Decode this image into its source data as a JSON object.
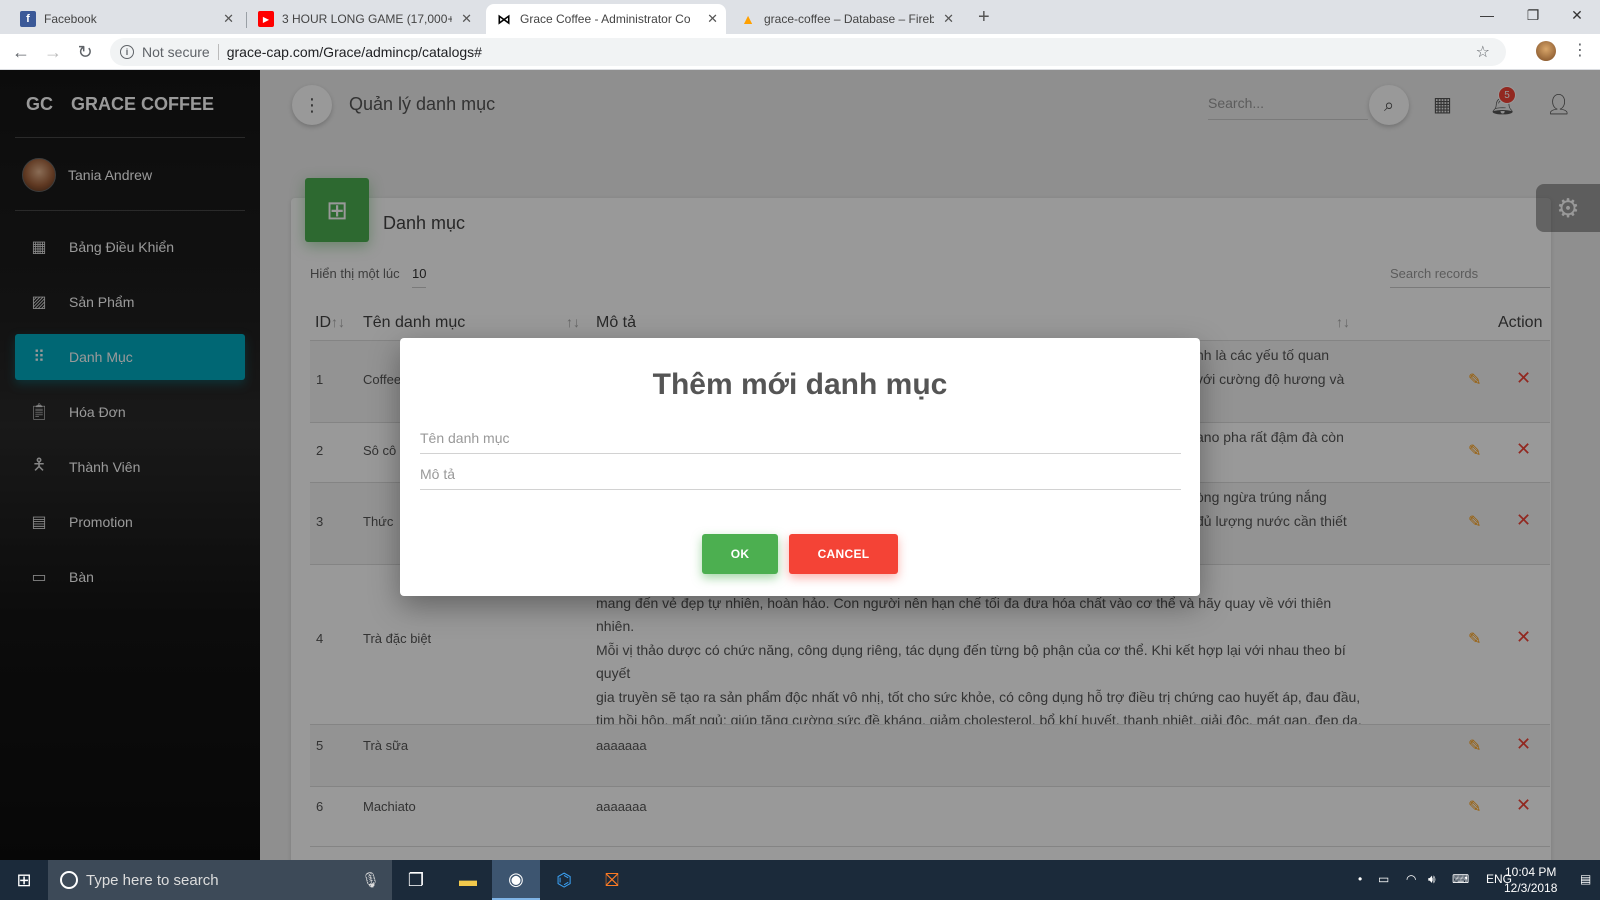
{
  "browser": {
    "tabs": [
      {
        "title": "Facebook",
        "icon": "facebook-icon",
        "color": "#3b5998"
      },
      {
        "title": "3 HOUR LONG GAME (17,000+ A",
        "icon": "youtube-icon",
        "color": "#ff0000"
      },
      {
        "title": "Grace Coffee - Administrator Cor",
        "icon": "bowtie-icon",
        "color": "#000000"
      },
      {
        "title": "grace-coffee – Database – Fireba",
        "icon": "firebase-icon",
        "color": "#ffa000"
      }
    ],
    "security_label": "Not secure",
    "url": "grace-cap.com/Grace/admincp/catalogs#"
  },
  "sidebar": {
    "brand_mini": "GC",
    "brand_name": "GRACE COFFEE",
    "user_name": "Tania Andrew",
    "items": [
      {
        "label": "Bảng Điều Khiển",
        "icon": "dashboard-icon"
      },
      {
        "label": "Sản Phẩm",
        "icon": "image-icon"
      },
      {
        "label": "Danh Mục",
        "icon": "apps-grid-icon"
      },
      {
        "label": "Hóa Đơn",
        "icon": "clipboard-icon"
      },
      {
        "label": "Thành Viên",
        "icon": "person-icon"
      },
      {
        "label": "Promotion",
        "icon": "calendar-icon"
      },
      {
        "label": "Bàn",
        "icon": "folder-icon"
      }
    ],
    "active_index": 2
  },
  "topbar": {
    "title": "Quản lý danh mục",
    "search_placeholder": "Search...",
    "notification_count": "5"
  },
  "card": {
    "title": "Danh mục",
    "show_label": "Hiển thị một lúc",
    "show_value": "10",
    "search_placeholder": "Search records",
    "columns": {
      "id": "ID",
      "name": "Tên danh mục",
      "desc": "Mô tả",
      "action": "Action"
    },
    "rows": [
      {
        "id": "1",
        "name": "Coffee",
        "desc": "nh là các yếu tố quan\nvới cường độ hương và"
      },
      {
        "id": "2",
        "name": "Sô cô",
        "desc": "ano pha rất đậm đà còn"
      },
      {
        "id": "3",
        "name": "Thức",
        "desc": "òng ngừa trúng nắng\nđủ lượng nước cần thiết"
      },
      {
        "id": "4",
        "name": "Trà đặc biệt",
        "desc": "hể khỏe mạnh cũng như\nmang đến vẻ đẹp tự nhiên, hoàn hảo. Con người nên hạn chế tối đa đưa hóa chất vào cơ thể và hãy quay về với thiên nhiên.\nMỗi vị thảo dược có chức năng, công dụng riêng, tác dụng đến từng bộ phận của cơ thể. Khi kết hợp lại với nhau theo bí quyết\ngia truyền sẽ tạo ra sản phẩm độc nhất vô nhị, tốt cho sức khỏe, có công dụng hỗ trợ điều trị chứng cao huyết áp, đau đầu,\ntim hồi hộp, mất ngủ; giúp tăng cường sức đề kháng, giảm cholesterol, bổ khí huyết, thanh nhiệt, giải độc, mát gan, đẹp da,\nhết mụn. Ngoài ra, sản phẩm này còn tốt cho những người mắt yếu, tiểu đường, sỏi thận, đặc biệt rất thích hợp với phụ nữ."
      },
      {
        "id": "5",
        "name": "Trà sữa",
        "desc": "aaaaaaa"
      },
      {
        "id": "6",
        "name": "Machiato",
        "desc": "aaaaaaa"
      }
    ]
  },
  "modal": {
    "title": "Thêm mới danh mục",
    "name_placeholder": "Tên danh mục",
    "desc_placeholder": "Mô tả",
    "ok_label": "OK",
    "cancel_label": "CANCEL"
  },
  "taskbar": {
    "search_placeholder": "Type here to search",
    "language": "ENG",
    "time": "10:04 PM",
    "date": "12/3/2018"
  },
  "colors": {
    "accent": "#00acc1",
    "success": "#4caf50",
    "danger": "#f44336",
    "warning": "#ff9800"
  }
}
